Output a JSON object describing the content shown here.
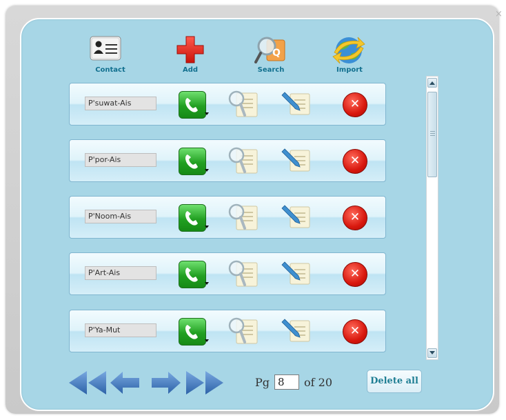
{
  "window": {
    "close_glyph": "×"
  },
  "toolbar": {
    "contact_label": "Contact",
    "add_label": "Add",
    "search_label": "Search",
    "import_label": "Import"
  },
  "contacts": [
    {
      "name": "P'suwat-Ais"
    },
    {
      "name": "P'por-Ais"
    },
    {
      "name": "P'Noom-Ais"
    },
    {
      "name": "P'Art-Ais"
    },
    {
      "name": "P'Ya-Mut"
    }
  ],
  "row_actions": {
    "delete_glyph": "✕",
    "phone_icon": "phone-icon",
    "view_icon": "view-details-icon",
    "edit_icon": "edit-icon",
    "delete_icon": "delete-icon"
  },
  "pager": {
    "pg_label": "Pg",
    "current_page": "8",
    "of_label": "of 20",
    "delete_all_label": "Delete all"
  },
  "colors": {
    "panel_bg": "#a7d6e6",
    "accent_text": "#12708f",
    "arrow_blue": "#3a73b8",
    "phone_green": "#22a022",
    "delete_red": "#d8180e"
  }
}
